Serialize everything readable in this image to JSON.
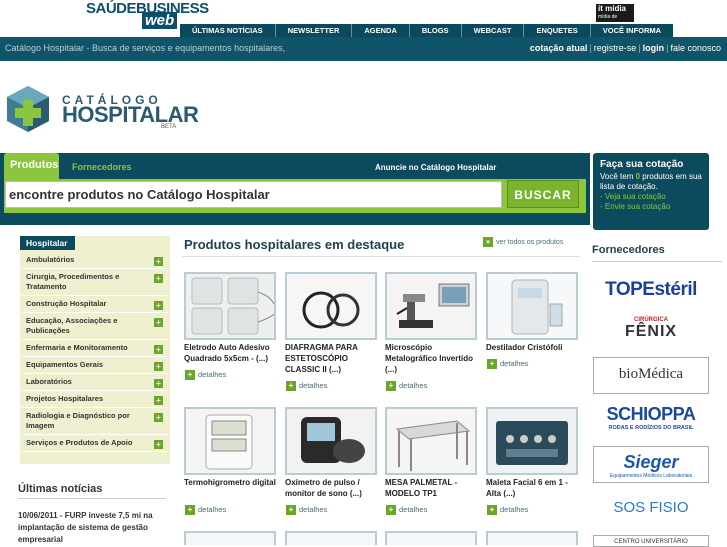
{
  "topbar": {
    "brand_main": "SAÚDEBUSINESS",
    "brand_web": "web",
    "partner_logo": "it mídia",
    "partner_sub": "mídia de negócios",
    "nav": [
      "ÚLTIMAS NOTÍCIAS",
      "NEWSLETTER",
      "AGENDA",
      "BLOGS",
      "WEBCAST",
      "ENQUETES",
      "VOCÊ INFORMA"
    ]
  },
  "bar2": {
    "breadcrumb": "Catálogo Hospitalar - Busca de serviços e equipamentos hospitalares, medici",
    "links": [
      "cotação atual",
      "registre-se",
      "login",
      "fale conosco"
    ]
  },
  "logo": {
    "line1": "CATÁLOGO",
    "line2": "HOSPITALAR",
    "line3": "BETA"
  },
  "search": {
    "tab_products": "Produtos",
    "tab_suppliers": "Fornecedores",
    "advertise": "Anuncie no Catálogo Hospitalar",
    "placeholder": "encontre produtos no Catálogo Hospitalar",
    "button": "BUSCAR"
  },
  "quote": {
    "title": "Faça sua cotação",
    "text_before": "Você tem ",
    "count": "0",
    "text_after": " produtos em sua lista de cotação.",
    "link1": "- Veja sua cotação",
    "link2": "- Envie sua cotação"
  },
  "sidebar": {
    "title": "Hospitalar",
    "items": [
      "Ambulatórios",
      "Cirurgia, Procedimentos e Tratamento",
      "Construção Hospitalar",
      "Educação, Associações e Publicações",
      "Enfermaria e Monitoramento",
      "Equipamentos Gerais",
      "Laboratórios",
      "Projetos Hospitalares",
      "Radiologia e Diagnóstico por Imagem",
      "Serviços e Produtos de Apoio"
    ]
  },
  "news": {
    "title": "Últimas notícias",
    "item": "10/06/2011 - FURP investe 7,5 mi na implantação de sistema de gestão empresarial"
  },
  "products": {
    "title": "Produtos hospitalares em destaque",
    "see_all": "ver todos os produtos",
    "details_label": "detalhes",
    "items": [
      {
        "name": "Eletrodo Auto Adesivo Quadrado 5x5cm - (...)"
      },
      {
        "name": "DIAFRAGMA PARA ESTETOSCÓPIO CLASSIC II (...)"
      },
      {
        "name": "Microscópio Metalográfico Invertido (...)"
      },
      {
        "name": "Destilador Cristófoli"
      },
      {
        "name": "Termohigrometro digital"
      },
      {
        "name": "Oxímetro de pulso / monitor de sono (...)"
      },
      {
        "name": "MESA PALMETAL - MODELO TP1"
      },
      {
        "name": "Maleta Facial 6 em 1 - Alta (...)"
      }
    ]
  },
  "suppliers": {
    "title": "Fornecedores",
    "items": [
      {
        "text": "TOPEstéril"
      },
      {
        "text": "FÊNIX",
        "sub": "CIRÚRGICA"
      },
      {
        "text": "bioMédica"
      },
      {
        "text": "SCHIOPPA",
        "sub": "RODAS E RODÍZIOS DO BRASIL"
      },
      {
        "text": "Sieger",
        "sub": "Equipamentos Médicos Laboratoriais"
      },
      {
        "text": "SOS FISIO"
      },
      {
        "text": "CENTRO UNIVERSITÁRIO"
      }
    ]
  },
  "colors": {
    "dark_teal": "#0c4a5e",
    "green": "#8cc63f",
    "sidebar_bg": "#eef0cf"
  }
}
